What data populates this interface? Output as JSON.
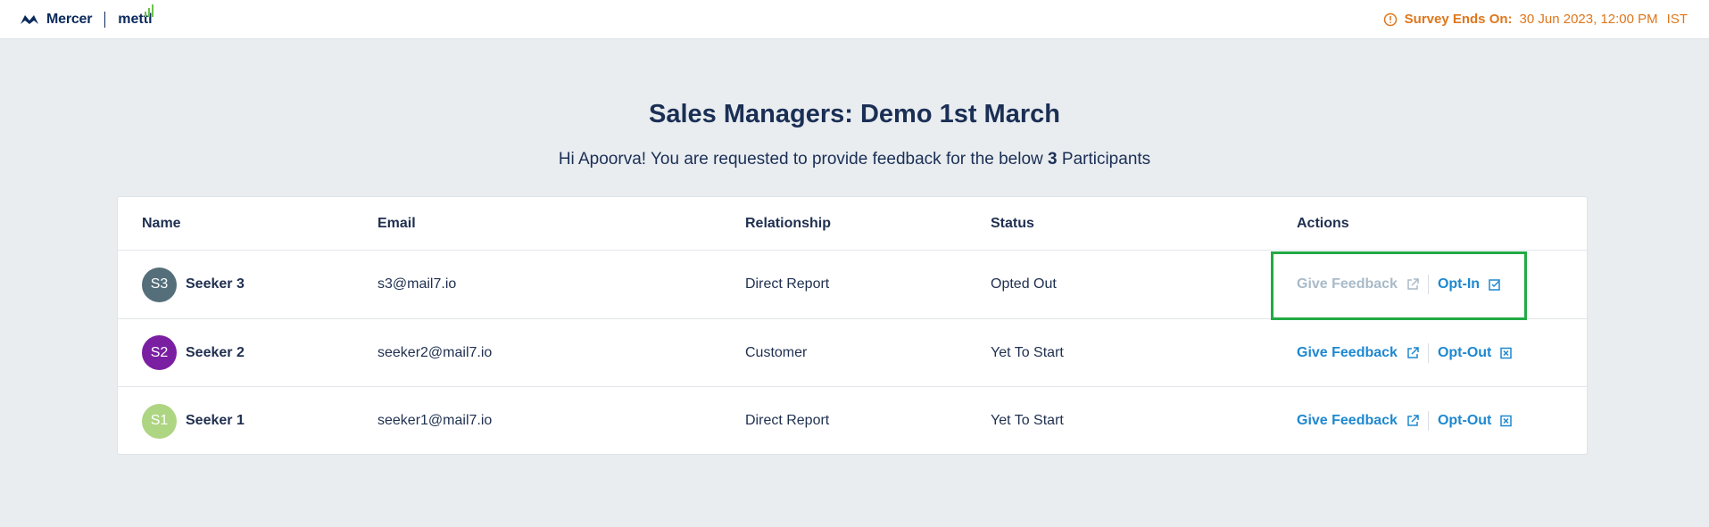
{
  "brand": {
    "left": "Mercer",
    "right": "mettl"
  },
  "survey": {
    "label": "Survey Ends On:",
    "value": "30 Jun 2023, 12:00 PM",
    "tz": "IST"
  },
  "page": {
    "title": "Sales Managers: Demo 1st March",
    "subtitle_prefix": "Hi Apoorva! You are requested to provide feedback for the below",
    "count": "3",
    "subtitle_suffix": "Participants"
  },
  "table": {
    "headers": {
      "name": "Name",
      "email": "Email",
      "relationship": "Relationship",
      "status": "Status",
      "actions": "Actions"
    },
    "rows": [
      {
        "initials": "S3",
        "name": "Seeker 3",
        "email": "s3@mail7.io",
        "relationship": "Direct Report",
        "status": "Opted Out",
        "feedback": "Give Feedback",
        "opt": "Opt-In",
        "avatar_color": "#546e7a"
      },
      {
        "initials": "S2",
        "name": "Seeker 2",
        "email": "seeker2@mail7.io",
        "relationship": "Customer",
        "status": "Yet To Start",
        "feedback": "Give Feedback",
        "opt": "Opt-Out",
        "avatar_color": "#7b1fa2"
      },
      {
        "initials": "S1",
        "name": "Seeker 1",
        "email": "seeker1@mail7.io",
        "relationship": "Direct Report",
        "status": "Yet To Start",
        "feedback": "Give Feedback",
        "opt": "Opt-Out",
        "avatar_color": "#aed581"
      }
    ]
  },
  "colors": {
    "accent": "#1e88d0",
    "warning": "#e0761c",
    "highlight": "#22aa44",
    "disabled": "#a9bac8"
  },
  "icons": {
    "alert": "alert-circle-icon",
    "external": "external-link-icon",
    "opt_in": "check-square-icon",
    "opt_out": "x-square-icon"
  }
}
